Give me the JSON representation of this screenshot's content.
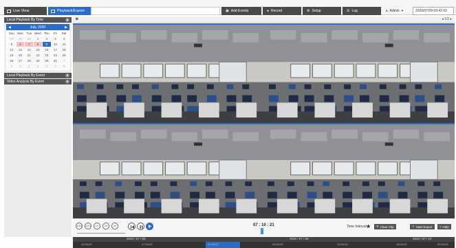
{
  "topbar": {
    "tabs": [
      {
        "label": "Live View",
        "icon": "monitor-icon"
      },
      {
        "label": "Playback/Export",
        "icon": "playback-icon"
      }
    ],
    "menu": [
      {
        "label": "Add Events",
        "icon": "event-icon"
      },
      {
        "label": "Record",
        "icon": "record-icon"
      },
      {
        "label": "Setup",
        "icon": "gear-icon"
      },
      {
        "label": "Log",
        "icon": "log-icon"
      }
    ],
    "user": "Admin",
    "datetime": "2020/07/09 09:42:03"
  },
  "sidebar": {
    "local_playback_time": "Local Playback By Time",
    "calendar": {
      "month_label": "July, 2020",
      "weekdays": [
        "Sun",
        "Mon",
        "Tue",
        "Wed",
        "Thu",
        "Fri",
        "Sat"
      ],
      "days": [
        {
          "d": "28",
          "s": "muted"
        },
        {
          "d": "29",
          "s": "muted"
        },
        {
          "d": "30",
          "s": "muted"
        },
        {
          "d": "1",
          "s": ""
        },
        {
          "d": "2",
          "s": ""
        },
        {
          "d": "3",
          "s": ""
        },
        {
          "d": "4",
          "s": ""
        },
        {
          "d": "5",
          "s": ""
        },
        {
          "d": "6",
          "s": "rec"
        },
        {
          "d": "7",
          "s": "rec"
        },
        {
          "d": "8",
          "s": "rec"
        },
        {
          "d": "9",
          "s": "today"
        },
        {
          "d": "10",
          "s": ""
        },
        {
          "d": "11",
          "s": ""
        },
        {
          "d": "12",
          "s": ""
        },
        {
          "d": "13",
          "s": ""
        },
        {
          "d": "14",
          "s": ""
        },
        {
          "d": "15",
          "s": ""
        },
        {
          "d": "16",
          "s": ""
        },
        {
          "d": "17",
          "s": ""
        },
        {
          "d": "18",
          "s": ""
        },
        {
          "d": "19",
          "s": ""
        },
        {
          "d": "20",
          "s": ""
        },
        {
          "d": "21",
          "s": ""
        },
        {
          "d": "22",
          "s": ""
        },
        {
          "d": "23",
          "s": ""
        },
        {
          "d": "24",
          "s": ""
        },
        {
          "d": "25",
          "s": ""
        },
        {
          "d": "26",
          "s": ""
        },
        {
          "d": "27",
          "s": ""
        },
        {
          "d": "28",
          "s": ""
        },
        {
          "d": "29",
          "s": ""
        },
        {
          "d": "30",
          "s": ""
        },
        {
          "d": "31",
          "s": ""
        },
        {
          "d": "1",
          "s": "muted"
        },
        {
          "d": "2",
          "s": "muted"
        },
        {
          "d": "3",
          "s": "muted"
        },
        {
          "d": "4",
          "s": "muted"
        },
        {
          "d": "5",
          "s": "muted"
        },
        {
          "d": "6",
          "s": "muted"
        },
        {
          "d": "7",
          "s": "muted"
        },
        {
          "d": "8",
          "s": "muted"
        }
      ]
    },
    "local_playback_event": "Local Playback By Event",
    "video_analysis_event": "Video Analysis By Event"
  },
  "viewtool": {
    "page": "1/2"
  },
  "controls": {
    "speed_buttons": [
      "1/4X",
      "1/2X",
      "1X",
      "2X",
      "4X"
    ],
    "timecode": "07 : 10 : 21",
    "time_interval_label": "Time Interval",
    "clear_clip": "Clear Clip",
    "start_export": "Start Export",
    "help": "Help"
  },
  "timeline": {
    "dates": [
      "2020 / 07 / 08",
      "2020 / 07 / 09",
      "2020 / 07 / 10"
    ],
    "times": [
      "10:00:00",
      "17:00:00",
      "00:00:00",
      "06:00:00",
      "12:00:00",
      "18:00:00",
      "00:00:00"
    ]
  },
  "colors": {
    "accent": "#2c6cc4",
    "dark": "#4a4a4a",
    "record_day": "#f3c4c4"
  }
}
